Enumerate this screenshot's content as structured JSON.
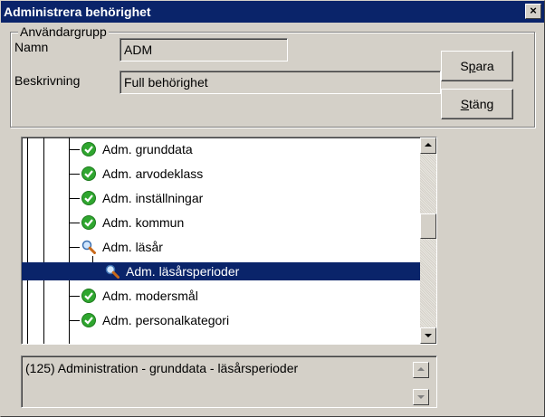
{
  "window": {
    "title": "Administrera behörighet",
    "close_label": "×"
  },
  "group": {
    "legend": "Användargrupp",
    "name_label": "Namn",
    "name_value": "ADM",
    "desc_label": "Beskrivning",
    "desc_value": "Full behörighet"
  },
  "buttons": {
    "save_pre": "S",
    "save_underline": "p",
    "save_post": "ara",
    "close_pre": "",
    "close_underline": "S",
    "close_post": "täng"
  },
  "tree": {
    "items": [
      {
        "label": "Adm. grunddata",
        "icon": "green-check-icon",
        "depth": 0
      },
      {
        "label": "Adm. arvodeklass",
        "icon": "green-check-icon",
        "depth": 0
      },
      {
        "label": "Adm. inställningar",
        "icon": "green-check-icon",
        "depth": 0
      },
      {
        "label": "Adm. kommun",
        "icon": "green-check-icon",
        "depth": 0
      },
      {
        "label": "Adm. läsår",
        "icon": "magnifier-icon",
        "depth": 0
      },
      {
        "label": "Adm. läsårsperioder",
        "icon": "magnifier-icon",
        "depth": 1,
        "selected": true
      },
      {
        "label": "Adm. modersmål",
        "icon": "green-check-icon",
        "depth": 0
      },
      {
        "label": "Adm. personalkategori",
        "icon": "green-check-icon",
        "depth": 0
      }
    ]
  },
  "description": {
    "text": "(125) Administration - grunddata - läsårsperioder"
  },
  "colors": {
    "titlebar": "#0a246a",
    "face": "#d4d0c8",
    "selection": "#0a246a",
    "check_green": "#2fa62f"
  }
}
